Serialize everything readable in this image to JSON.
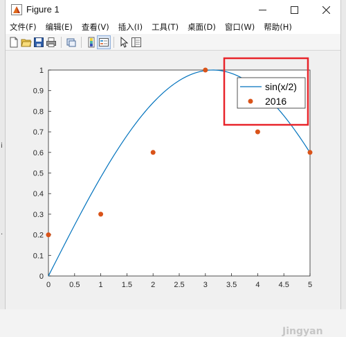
{
  "window": {
    "title": "Figure 1"
  },
  "menu": [
    {
      "label": "文件(F)"
    },
    {
      "label": "编辑(E)"
    },
    {
      "label": "查看(V)"
    },
    {
      "label": "插入(I)"
    },
    {
      "label": "工具(T)"
    },
    {
      "label": "桌面(D)"
    },
    {
      "label": "窗口(W)"
    },
    {
      "label": "帮助(H)"
    }
  ],
  "toolbar": {
    "icons": [
      "new-figure-icon",
      "open-file-icon",
      "save-icon",
      "print-icon",
      "link-plot-icon",
      "insert-colorbar-icon",
      "insert-legend-icon",
      "edit-plot-icon",
      "property-inspector-icon"
    ]
  },
  "colors": {
    "line": "#0072bd",
    "points": "#d95319",
    "highlight": "#e8242a"
  },
  "watermark": "Jingyan",
  "chart_data": {
    "type": "line",
    "title": "",
    "xlabel": "",
    "ylabel": "",
    "xlim": [
      0,
      5
    ],
    "ylim": [
      0,
      1
    ],
    "xticks": [
      "0",
      "0.5",
      "1",
      "1.5",
      "2",
      "2.5",
      "3",
      "3.5",
      "4",
      "4.5",
      "5"
    ],
    "yticks": [
      "0",
      "0.1",
      "0.2",
      "0.3",
      "0.4",
      "0.5",
      "0.6",
      "0.7",
      "0.8",
      "0.9",
      "1"
    ],
    "legend_position": "top-right",
    "series": [
      {
        "name": "sin(x/2)",
        "kind": "line",
        "function": "sin(x/2)",
        "x_from": 0,
        "x_to": 5
      },
      {
        "name": "2016",
        "kind": "scatter",
        "x": [
          0,
          1,
          2,
          3,
          4,
          5
        ],
        "y": [
          0.2,
          0.3,
          0.6,
          1.0,
          0.7,
          0.6
        ]
      }
    ]
  }
}
